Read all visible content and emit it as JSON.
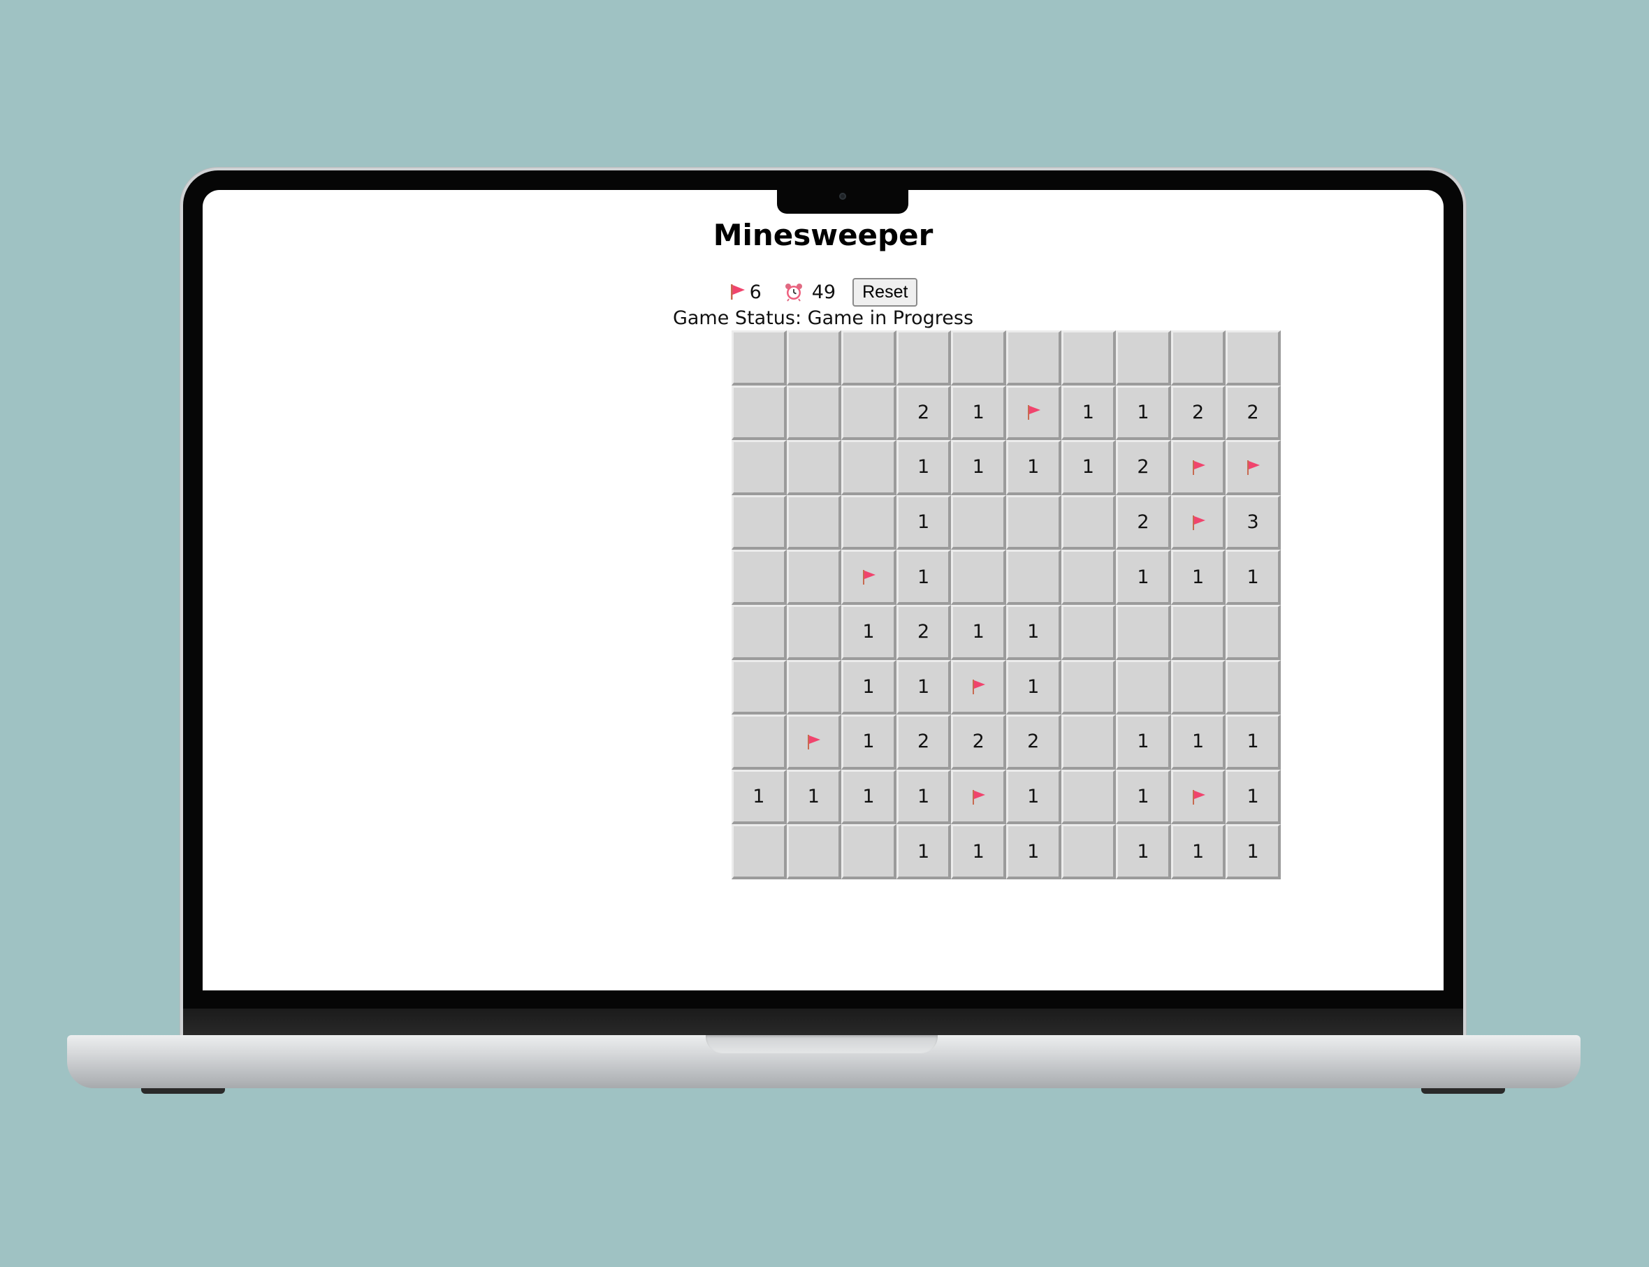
{
  "app": {
    "title": "Minesweeper",
    "flags_remaining": "6",
    "timer_seconds": "49",
    "reset_label": "Reset",
    "status_text": "Game Status: Game in Progress"
  },
  "colors": {
    "background": "#9fc2c3",
    "cell": "#d4d4d4",
    "flag": "#f0446d"
  },
  "icons": {
    "flag": "flag-icon",
    "timer": "alarm-clock-icon"
  },
  "board": {
    "rows": 10,
    "cols": 10,
    "cells": [
      [
        "",
        "",
        "",
        "",
        "",
        "",
        "",
        "",
        "",
        ""
      ],
      [
        "",
        "",
        "",
        "2",
        "1",
        "F",
        "1",
        "1",
        "2",
        "2"
      ],
      [
        "",
        "",
        "",
        "1",
        "1",
        "1",
        "1",
        "2",
        "F",
        "F"
      ],
      [
        "",
        "",
        "",
        "1",
        "",
        "",
        "",
        "2",
        "F",
        "3"
      ],
      [
        "",
        "",
        "F",
        "1",
        "",
        "",
        "",
        "1",
        "1",
        "1"
      ],
      [
        "",
        "",
        "1",
        "2",
        "1",
        "1",
        "",
        "",
        "",
        ""
      ],
      [
        "",
        "",
        "1",
        "1",
        "F",
        "1",
        "",
        "",
        "",
        ""
      ],
      [
        "",
        "F",
        "1",
        "2",
        "2",
        "2",
        "",
        "1",
        "1",
        "1"
      ],
      [
        "1",
        "1",
        "1",
        "1",
        "F",
        "1",
        "",
        "1",
        "F",
        "1"
      ],
      [
        "",
        "",
        "",
        "1",
        "1",
        "1",
        "",
        "1",
        "1",
        "1"
      ]
    ]
  }
}
